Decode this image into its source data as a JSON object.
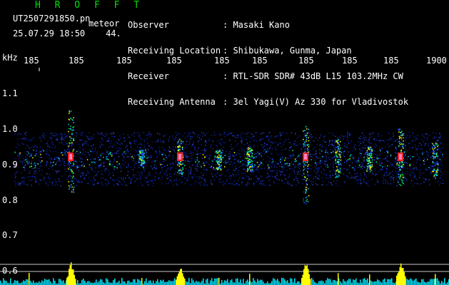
{
  "header": {
    "station": "H R O F F T",
    "filename": "UT2507291850.pn",
    "mode": "meteor",
    "date": "25.07.29 18:50",
    "count": "44.",
    "fields": [
      {
        "label": "Observer",
        "value": ": Masaki Kano"
      },
      {
        "label": "Receiving Location",
        "value": ": Shibukawa, Gunma, Japan"
      },
      {
        "label": "Receiver",
        "value": ": RTL-SDR SDR# 43dB L15 103.2MHz CW"
      },
      {
        "label": "Receiving Antenna",
        "value": ": 3el Yagi(V) Az 330 for Vladivostok"
      }
    ]
  },
  "axes": {
    "y_unit": "kHz",
    "x_ticks": [
      "185",
      "185",
      "185",
      "185",
      "185",
      "185",
      "185",
      "185",
      "185",
      "1900"
    ],
    "y_ticks": [
      "1.1",
      "1.0",
      "0.9",
      "0.8",
      "0.7",
      "0.6"
    ]
  },
  "colors": {
    "header_green": "#00e000",
    "text_white": "#ffffff",
    "background": "#000000",
    "activity_bar": "#ffff00",
    "noise_cyan": "#00ffff"
  }
}
